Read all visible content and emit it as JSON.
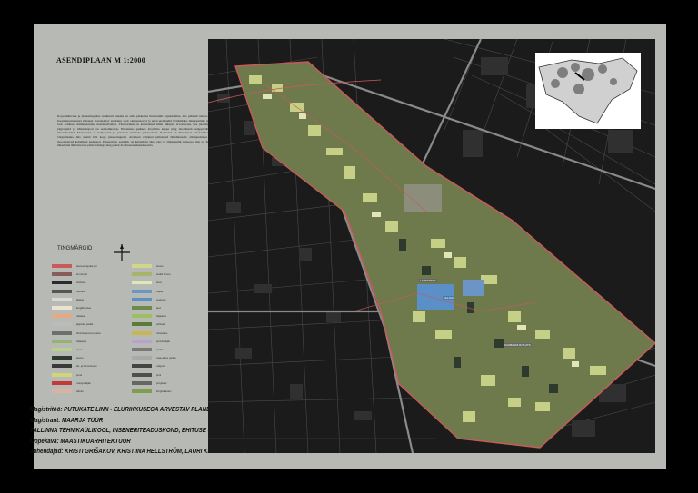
{
  "title": "ASENDIPLAAN M 1:2000",
  "description": "Kogu liikuvuse ja planeeringulise struktuuri aluseks on selle piirkonna linnaruumi kujundamine, mis põhineb tänava- ja hoonestusstruktuuri ühtsusel. Kavandatav struktuur seob olemasolevad ja uued elemendid terviklikuks linnaruumiks ning loob eeldused mitmekesistele kasutusviisidele. Tänavaruum on kavandatud kõiki liikujaid arvestavana, kus jalakäijad, jalgratturid ja ühistransport on eelisolukorras. Hoonestus paikneb kvartalite kaupa ning moodustab selgepiirilised tänavafrondid. Sisehoovid on haljastatud ja pakuvad elanikele puhkealasid. Rohealad on ühendatud rohekoridoride võrgustikuks, mis ulatub läbi kogu planeeringuala. Avalikud väljakud paiknevad liikumisteede sõlmpunktides ja moodustavad kohalikud keskused. Planeeringu eesmärk on kujundada tihe, elav ja jätkusuutlik linnaosa, mis on hästi ühendatud ümbritsevate piirkondadega ning pakub kvaliteetset elukeskkonda.",
  "legend": {
    "title": "TINGMÄRGID",
    "items_left": [
      {
        "label": "planeeringuala piir",
        "color": "#c85a5a"
      },
      {
        "label": "krundi piir",
        "color": "#8a5d5d"
      },
      {
        "label": "sõidutee",
        "color": "#2b2b2b"
      },
      {
        "label": "raudtee",
        "color": "#555555"
      },
      {
        "label": "jalgtee",
        "color": "#d8d8d8"
      },
      {
        "label": "kergliiklustee",
        "color": "#e9e3cf"
      },
      {
        "label": "rattatee",
        "color": "#e6a982"
      },
      {
        "label": "jalgratta parkla",
        "color": "#bcbcbc"
      },
      {
        "label": "ühistranspordi peatus",
        "color": "#6e6e6e"
      },
      {
        "label": "haljasala",
        "color": "#94b373"
      },
      {
        "label": "muru",
        "color": "#b9cf8e"
      },
      {
        "label": "elamu",
        "color": "#2f3a2f"
      },
      {
        "label": "äri- ja büroohoone",
        "color": "#3a3a3a"
      },
      {
        "label": "puud",
        "color": "#d1d47a"
      },
      {
        "label": "mänguväljak",
        "color": "#c23a3a"
      },
      {
        "label": "sillutis",
        "color": "#d9b3a0"
      }
    ],
    "items_right": [
      {
        "label": "hoone",
        "color": "#d2d68c"
      },
      {
        "label": "avalik hoone",
        "color": "#a7b56a"
      },
      {
        "label": "hoov",
        "color": "#e3e5b9"
      },
      {
        "label": "väljak",
        "color": "#6b95c4"
      },
      {
        "label": "veekogu",
        "color": "#5a8fc7"
      },
      {
        "label": "aed",
        "color": "#6c8a4a"
      },
      {
        "label": "haljastus",
        "color": "#9fbf5e"
      },
      {
        "label": "põõsad",
        "color": "#5d7a3b"
      },
      {
        "label": "rohekatus",
        "color": "#c8b750"
      },
      {
        "label": "spordiväljak",
        "color": "#b9a0d0"
      },
      {
        "label": "parkla",
        "color": "#7a7a7a"
      },
      {
        "label": "maa-alune parkla",
        "color": "#a9a9a9"
      },
      {
        "label": "valgusti",
        "color": "#444444"
      },
      {
        "label": "pink",
        "color": "#505050"
      },
      {
        "label": "prügikast",
        "color": "#666666"
      },
      {
        "label": "kõrghaljastus",
        "color": "#7e9d4f"
      }
    ]
  },
  "credits": {
    "thesis": "Magistritöö: PUTUKATE LINN - ELURIKKUSEGA ARVESTAV PLANEER",
    "student": "Magistrant: MAARJA TÜÜR",
    "institution": "TALLINNA TEHNIKAÜLIKOOL, INSENERITEADUSKOND, EHITUSE JA A",
    "program": "Õppekava: MAASTIKUARHITEKTUUR",
    "supervisors": "Juhendajad: KRISTI GRIŠAKOV, KRISTIINA HELLSTRÖM, LAURI KLEIRE"
  },
  "map_labels": {
    "label1": "LAPSEPARK",
    "label2": "VALJAK",
    "label3": "KAUBANDUS PLATS"
  },
  "colors": {
    "sheet": "#b7b9b4",
    "map_bg": "#1a1a1a",
    "boundary": "#c85a5a",
    "road": "#8a8a8a"
  }
}
